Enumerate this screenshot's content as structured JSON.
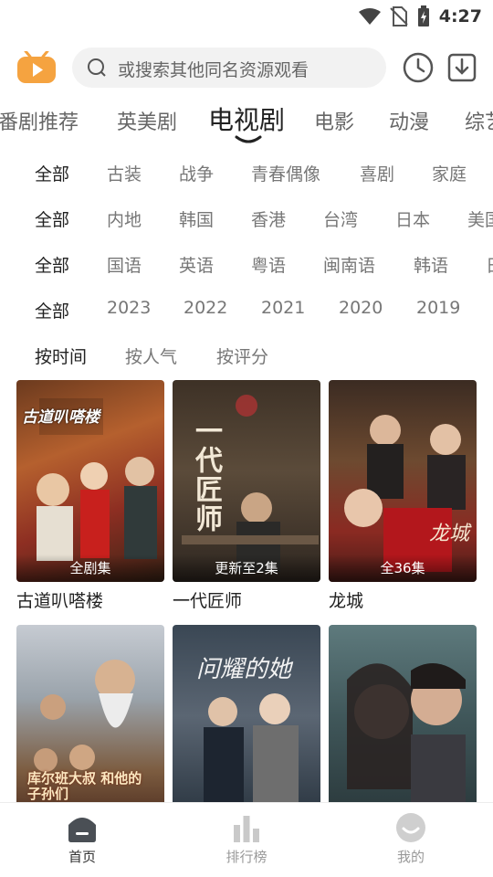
{
  "status": {
    "time": "4:27"
  },
  "header": {
    "search_placeholder": "或搜索其他同名资源观看",
    "logo_icon": "play-tv-icon",
    "history_icon": "clock-icon",
    "download_icon": "download-icon"
  },
  "tabs": [
    {
      "label": "番剧推荐"
    },
    {
      "label": "英美剧"
    },
    {
      "label": "电视剧",
      "active": true
    },
    {
      "label": "电影"
    },
    {
      "label": "动漫"
    },
    {
      "label": "综艺"
    }
  ],
  "filters": {
    "genre": [
      "全部",
      "古装",
      "战争",
      "青春偶像",
      "喜剧",
      "家庭"
    ],
    "region": [
      "全部",
      "内地",
      "韩国",
      "香港",
      "台湾",
      "日本",
      "美国"
    ],
    "language": [
      "全部",
      "国语",
      "英语",
      "粤语",
      "闽南语",
      "韩语",
      "日语"
    ],
    "year": [
      "全部",
      "2023",
      "2022",
      "2021",
      "2020",
      "2019"
    ],
    "sort": [
      "按时间",
      "按人气",
      "按评分"
    ]
  },
  "cards": [
    {
      "title": "古道叭嗒楼",
      "badge": "全剧集",
      "poster_text": "古道叭嗒楼"
    },
    {
      "title": "一代匠师",
      "badge": "更新至2集",
      "poster_text": "一代匠师"
    },
    {
      "title": "龙城",
      "badge": "全36集",
      "poster_text": "龙城"
    },
    {
      "title": "",
      "badge": "",
      "poster_text": "库尔班大叔 和他的子孙们"
    },
    {
      "title": "",
      "badge": "",
      "poster_text": "问耀的她"
    },
    {
      "title": "",
      "badge": "",
      "poster_text": ""
    }
  ],
  "nav": [
    {
      "label": "首页",
      "icon": "home-icon",
      "active": true
    },
    {
      "label": "排行榜",
      "icon": "bar-chart-icon"
    },
    {
      "label": "我的",
      "icon": "profile-icon"
    }
  ],
  "colors": {
    "accent": "#f5a340",
    "active_text": "#222222",
    "muted_text": "#777777"
  }
}
